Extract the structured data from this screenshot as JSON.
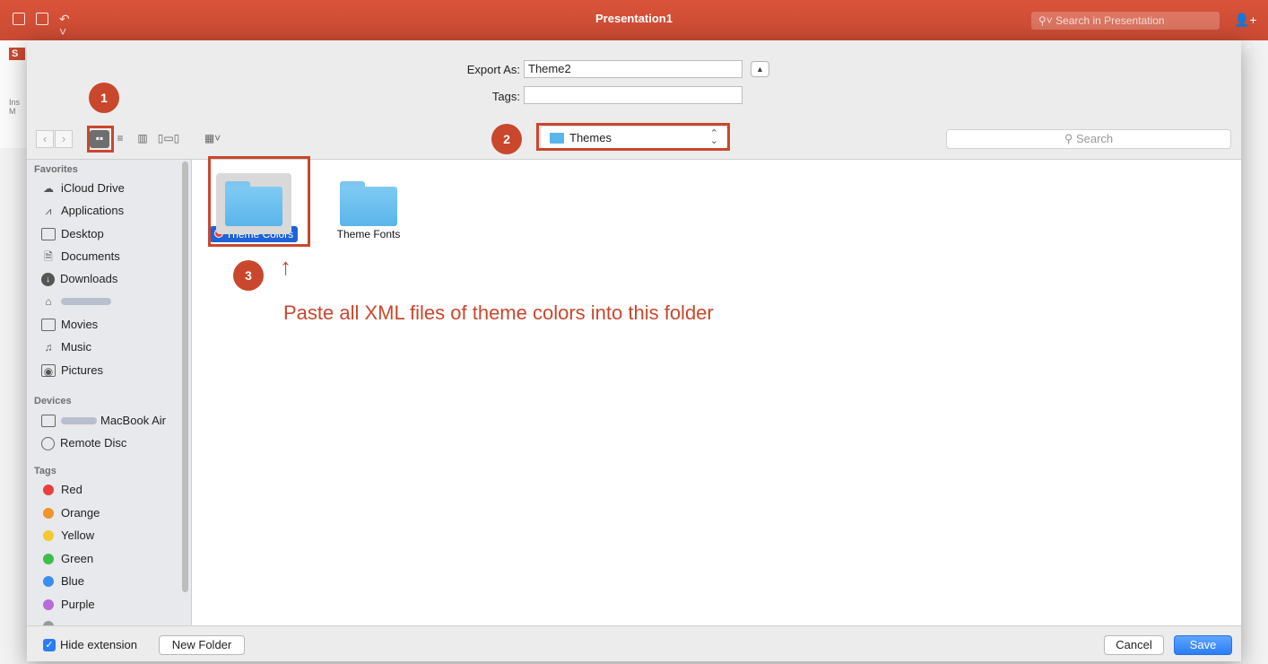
{
  "app": {
    "title": "Presentation1",
    "search_placeholder": "Search in Presentation",
    "ribbon_tab_letter": "S",
    "ribbon_label": "Ins\nM"
  },
  "dialog": {
    "export_as_label": "Export As:",
    "export_as_value": "Theme2",
    "tags_label": "Tags:",
    "tags_value": "",
    "location": "Themes",
    "search_placeholder": "Search",
    "hide_extension_label": "Hide extension",
    "hide_extension_checked": true,
    "new_folder_label": "New Folder",
    "cancel_label": "Cancel",
    "save_label": "Save"
  },
  "sidebar": {
    "favorites_heading": "Favorites",
    "favorites": [
      {
        "label": "iCloud Drive",
        "icon": "cloud-icon"
      },
      {
        "label": "Applications",
        "icon": "applications-icon"
      },
      {
        "label": "Desktop",
        "icon": "desktop-icon"
      },
      {
        "label": "Documents",
        "icon": "documents-icon"
      },
      {
        "label": "Downloads",
        "icon": "downloads-icon"
      },
      {
        "label": "",
        "icon": "home-icon"
      },
      {
        "label": "Movies",
        "icon": "movies-icon"
      },
      {
        "label": "Music",
        "icon": "music-icon"
      },
      {
        "label": "Pictures",
        "icon": "pictures-icon"
      }
    ],
    "devices_heading": "Devices",
    "devices": [
      {
        "label": "MacBook Air",
        "icon": "laptop-icon"
      },
      {
        "label": "Remote Disc",
        "icon": "disc-icon"
      }
    ],
    "tags_heading": "Tags",
    "tags": [
      {
        "label": "Red",
        "color": "#e93f3f"
      },
      {
        "label": "Orange",
        "color": "#f0952c"
      },
      {
        "label": "Yellow",
        "color": "#f3c833"
      },
      {
        "label": "Green",
        "color": "#3fbd4a"
      },
      {
        "label": "Blue",
        "color": "#3b8ef0"
      },
      {
        "label": "Purple",
        "color": "#b86ad6"
      }
    ]
  },
  "files": [
    {
      "name": "Theme Colors",
      "selected": true,
      "tag_color": "#e93f3f"
    },
    {
      "name": "Theme Fonts",
      "selected": false
    }
  ],
  "annotations": {
    "badge1": "1",
    "badge2": "2",
    "badge3": "3",
    "arrow": "↑",
    "instruction": "Paste all XML files of theme colors into this folder"
  },
  "colors": {
    "accent": "#c9472d",
    "selection": "#1f63d8",
    "primary_button": "#2a7df5"
  }
}
